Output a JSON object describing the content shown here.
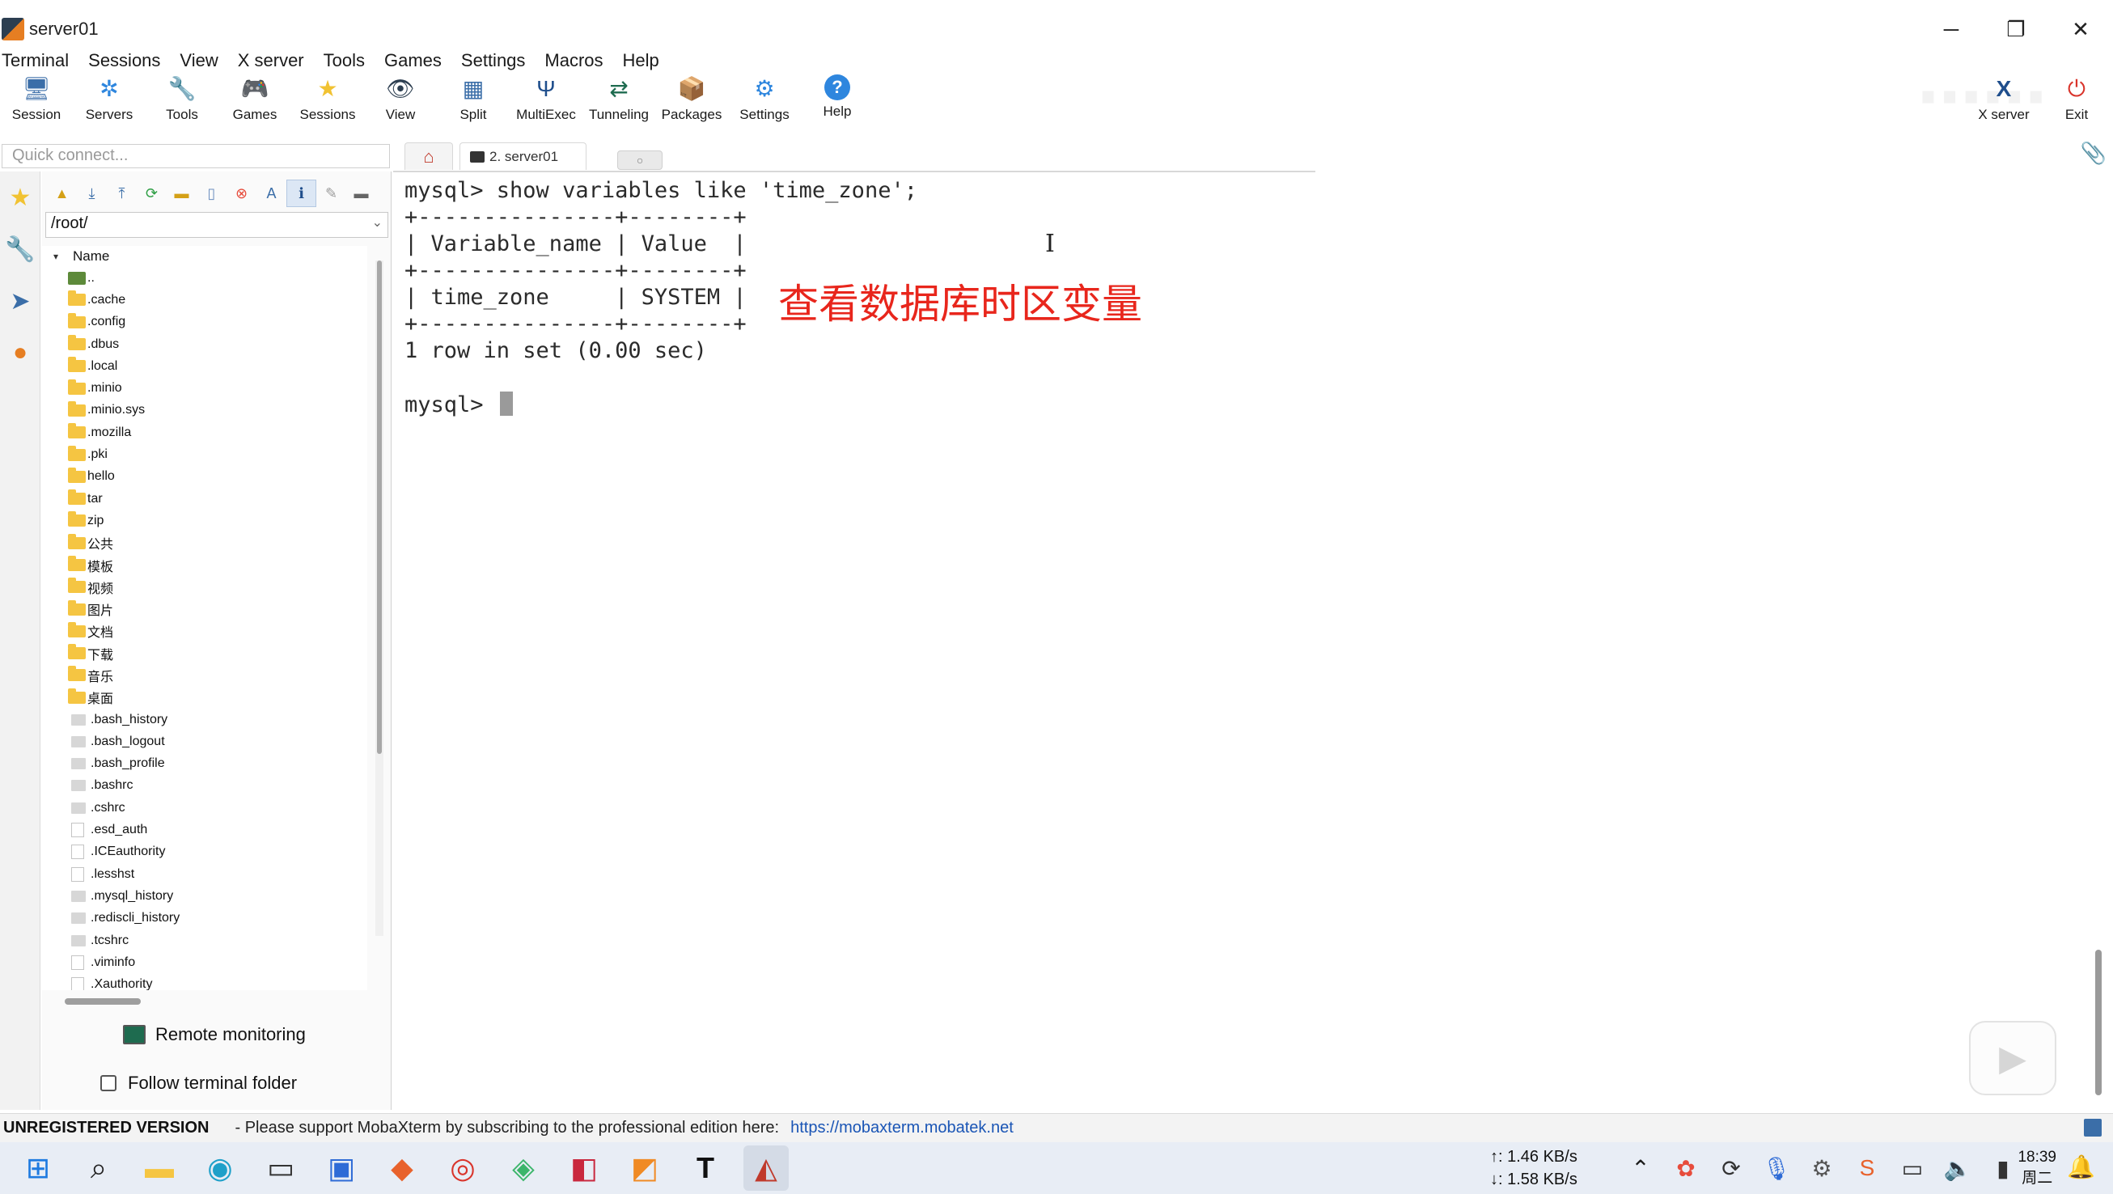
{
  "window": {
    "title": "server01",
    "controls": {
      "minimize": "─",
      "restore": "❐",
      "close": "✕"
    }
  },
  "menu": [
    "Terminal",
    "Sessions",
    "View",
    "X server",
    "Tools",
    "Games",
    "Settings",
    "Macros",
    "Help"
  ],
  "toolbar": {
    "left": [
      {
        "label": "Session",
        "icon": "session-icon",
        "glyph": "🖥"
      },
      {
        "label": "Servers",
        "icon": "servers-icon",
        "glyph": "✲"
      },
      {
        "label": "Tools",
        "icon": "tools-icon",
        "glyph": "🔧"
      },
      {
        "label": "Games",
        "icon": "games-icon",
        "glyph": "🎮"
      },
      {
        "label": "Sessions",
        "icon": "sessions-star-icon",
        "glyph": "★"
      },
      {
        "label": "View",
        "icon": "view-icon",
        "glyph": "👁"
      },
      {
        "label": "Split",
        "icon": "split-icon",
        "glyph": "▦"
      },
      {
        "label": "MultiExec",
        "icon": "multiexec-icon",
        "glyph": "Ψ"
      },
      {
        "label": "Tunneling",
        "icon": "tunneling-icon",
        "glyph": "⇄"
      },
      {
        "label": "Packages",
        "icon": "packages-icon",
        "glyph": "📦"
      },
      {
        "label": "Settings",
        "icon": "settings-icon",
        "glyph": "⚙"
      },
      {
        "label": "Help",
        "icon": "help-icon",
        "glyph": "?"
      }
    ],
    "right": [
      {
        "label": "X server",
        "icon": "xserver-icon",
        "glyph": "X"
      },
      {
        "label": "Exit",
        "icon": "exit-icon",
        "glyph": "⏻"
      }
    ]
  },
  "quick_connect": {
    "placeholder": "Quick connect..."
  },
  "tabs": {
    "home_glyph": "⌂",
    "session_label": "2. server01",
    "new_tab_glyph": "○",
    "attach_glyph": "📎"
  },
  "side_strip": [
    {
      "icon": "favorites-star-icon",
      "glyph": "★",
      "color": "#f1c232"
    },
    {
      "icon": "tools-icon",
      "glyph": "🔧",
      "color": "#c0392b"
    },
    {
      "icon": "send-icon",
      "glyph": "➤",
      "color": "#3b6ea8"
    },
    {
      "icon": "globe-icon",
      "glyph": "●",
      "color": "#e67e22"
    }
  ],
  "browser": {
    "path": "/root/",
    "column_header": "Name",
    "entries": [
      {
        "name": "..",
        "type": "up"
      },
      {
        "name": ".cache",
        "type": "folder"
      },
      {
        "name": ".config",
        "type": "folder"
      },
      {
        "name": ".dbus",
        "type": "folder"
      },
      {
        "name": ".local",
        "type": "folder"
      },
      {
        "name": ".minio",
        "type": "folder"
      },
      {
        "name": ".minio.sys",
        "type": "folder"
      },
      {
        "name": ".mozilla",
        "type": "folder"
      },
      {
        "name": ".pki",
        "type": "folder"
      },
      {
        "name": "hello",
        "type": "folder"
      },
      {
        "name": "tar",
        "type": "folder"
      },
      {
        "name": "zip",
        "type": "folder"
      },
      {
        "name": "公共",
        "type": "folder"
      },
      {
        "name": "模板",
        "type": "folder"
      },
      {
        "name": "视频",
        "type": "folder"
      },
      {
        "name": "图片",
        "type": "folder"
      },
      {
        "name": "文档",
        "type": "folder"
      },
      {
        "name": "下载",
        "type": "folder"
      },
      {
        "name": "音乐",
        "type": "folder"
      },
      {
        "name": "桌面",
        "type": "folder"
      },
      {
        "name": ".bash_history",
        "type": "file"
      },
      {
        "name": ".bash_logout",
        "type": "file"
      },
      {
        "name": ".bash_profile",
        "type": "file"
      },
      {
        "name": ".bashrc",
        "type": "file"
      },
      {
        "name": ".cshrc",
        "type": "file"
      },
      {
        "name": ".esd_auth",
        "type": "doc"
      },
      {
        "name": ".ICEauthority",
        "type": "doc"
      },
      {
        "name": ".lesshst",
        "type": "doc"
      },
      {
        "name": ".mysql_history",
        "type": "file"
      },
      {
        "name": ".rediscli_history",
        "type": "file"
      },
      {
        "name": ".tcshrc",
        "type": "file"
      },
      {
        "name": ".viminfo",
        "type": "doc"
      },
      {
        "name": ".Xauthority",
        "type": "doc"
      }
    ],
    "remote_monitoring": "Remote monitoring",
    "follow_terminal": "Follow terminal folder"
  },
  "terminal": {
    "lines": [
      "mysql> show variables like 'time_zone';",
      "+---------------+--------+",
      "| Variable_name | Value  |",
      "+---------------+--------+",
      "| time_zone     | SYSTEM |",
      "+---------------+--------+",
      "1 row in set (0.00 sec)",
      "",
      "mysql> "
    ],
    "annotation": "查看数据库时区变量",
    "annotation_color": "#e8261c"
  },
  "status": {
    "unregistered": "UNREGISTERED VERSION",
    "support_text": "-  Please support MobaXterm by subscribing to the professional edition here:",
    "link": "https://mobaxterm.mobatek.net"
  },
  "taskbar": {
    "upload": "↑: 1.46 KB/s",
    "download": "↓: 1.58 KB/s",
    "time": "18:39",
    "day": "周二"
  },
  "colors": {
    "accent": "#3b6ea8",
    "link": "#1a55b5",
    "folder": "#f5c542"
  }
}
